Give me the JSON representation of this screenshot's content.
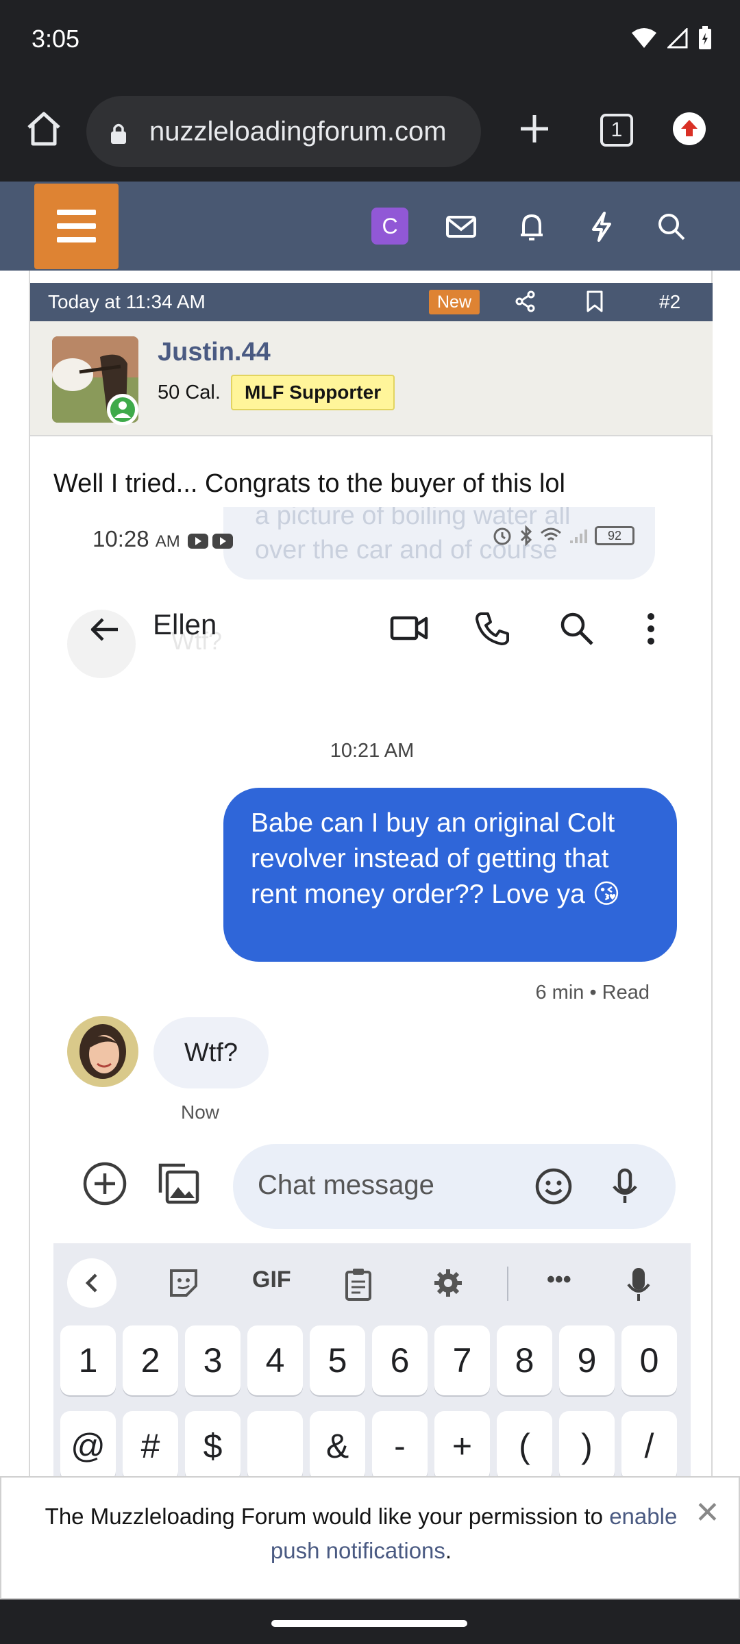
{
  "status_bar": {
    "time": "3:05"
  },
  "browser": {
    "url": "nuzzleloadingforum.com",
    "tab_count": "1"
  },
  "forum_header": {
    "account_initial": "C"
  },
  "post": {
    "timestamp": "Today at 11:34 AM",
    "new_badge": "New",
    "post_number": "#2",
    "author": "Justin.44",
    "author_title": "50 Cal.",
    "author_banner": "MLF Supporter",
    "text": "Well I tried... Congrats to the buyer of this lol"
  },
  "embedded": {
    "ghost_text_line1": "a picture of boiling water all",
    "ghost_text_line2": "over the car and of course",
    "time": "10:28",
    "time_suffix": "AM",
    "battery": "92",
    "contact_name": "Ellen",
    "ghost_reply": "Wtf?",
    "day_time": "10:21 AM",
    "outgoing_message": "Babe can I buy an original Colt revolver instead of getting that rent money order?? Love ya 😘",
    "outgoing_meta": "6 min • Read",
    "incoming_message": "Wtf?",
    "incoming_time": "Now",
    "composer_placeholder": "Chat message",
    "keyboard_gif": "GIF",
    "keyboard_more": "•••",
    "number_keys": [
      "1",
      "2",
      "3",
      "4",
      "5",
      "6",
      "7",
      "8",
      "9",
      "0"
    ],
    "symbol_keys": [
      "@",
      "#",
      "$",
      "",
      "&",
      "-",
      "+",
      "(",
      ")",
      "/"
    ]
  },
  "push_prompt": {
    "text_before": "The Muzzleloading Forum would like your permission to ",
    "link_text": "enable push notifications",
    "text_after": ".",
    "close": "✕"
  },
  "colors": {
    "forum_header": "#495872",
    "menu_button": "#de8333",
    "new_badge": "#de8333",
    "outgoing_bubble": "#2f66d9",
    "supporter_banner": "#fff59a"
  }
}
